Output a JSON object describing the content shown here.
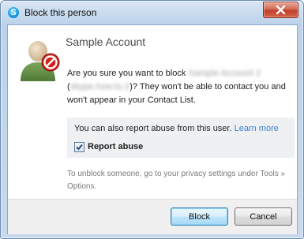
{
  "window": {
    "title": "Block this person",
    "app_icon": "skype-icon",
    "close_icon": "close-icon"
  },
  "account": {
    "name": "Sample Account",
    "avatar_icon": "blocked-user-icon"
  },
  "message": {
    "prefix": "Are you sure you want to block ",
    "blocked_name": "Sample Account 2",
    "open_paren": " (",
    "blocked_id": "skype.how.to.2",
    "suffix": ")? They won't be able to contact you and won't appear in your Contact List."
  },
  "report": {
    "text": "You can also report abuse from this user. ",
    "learn_more": "Learn more",
    "checkbox_label": "Report abuse",
    "checked": true
  },
  "hint": "To unblock someone, go to your privacy settings under Tools » Options.",
  "buttons": {
    "block": "Block",
    "cancel": "Cancel"
  },
  "colors": {
    "link": "#3a7fcf",
    "close_button": "#c7442f",
    "block_sign": "#d4201a"
  }
}
